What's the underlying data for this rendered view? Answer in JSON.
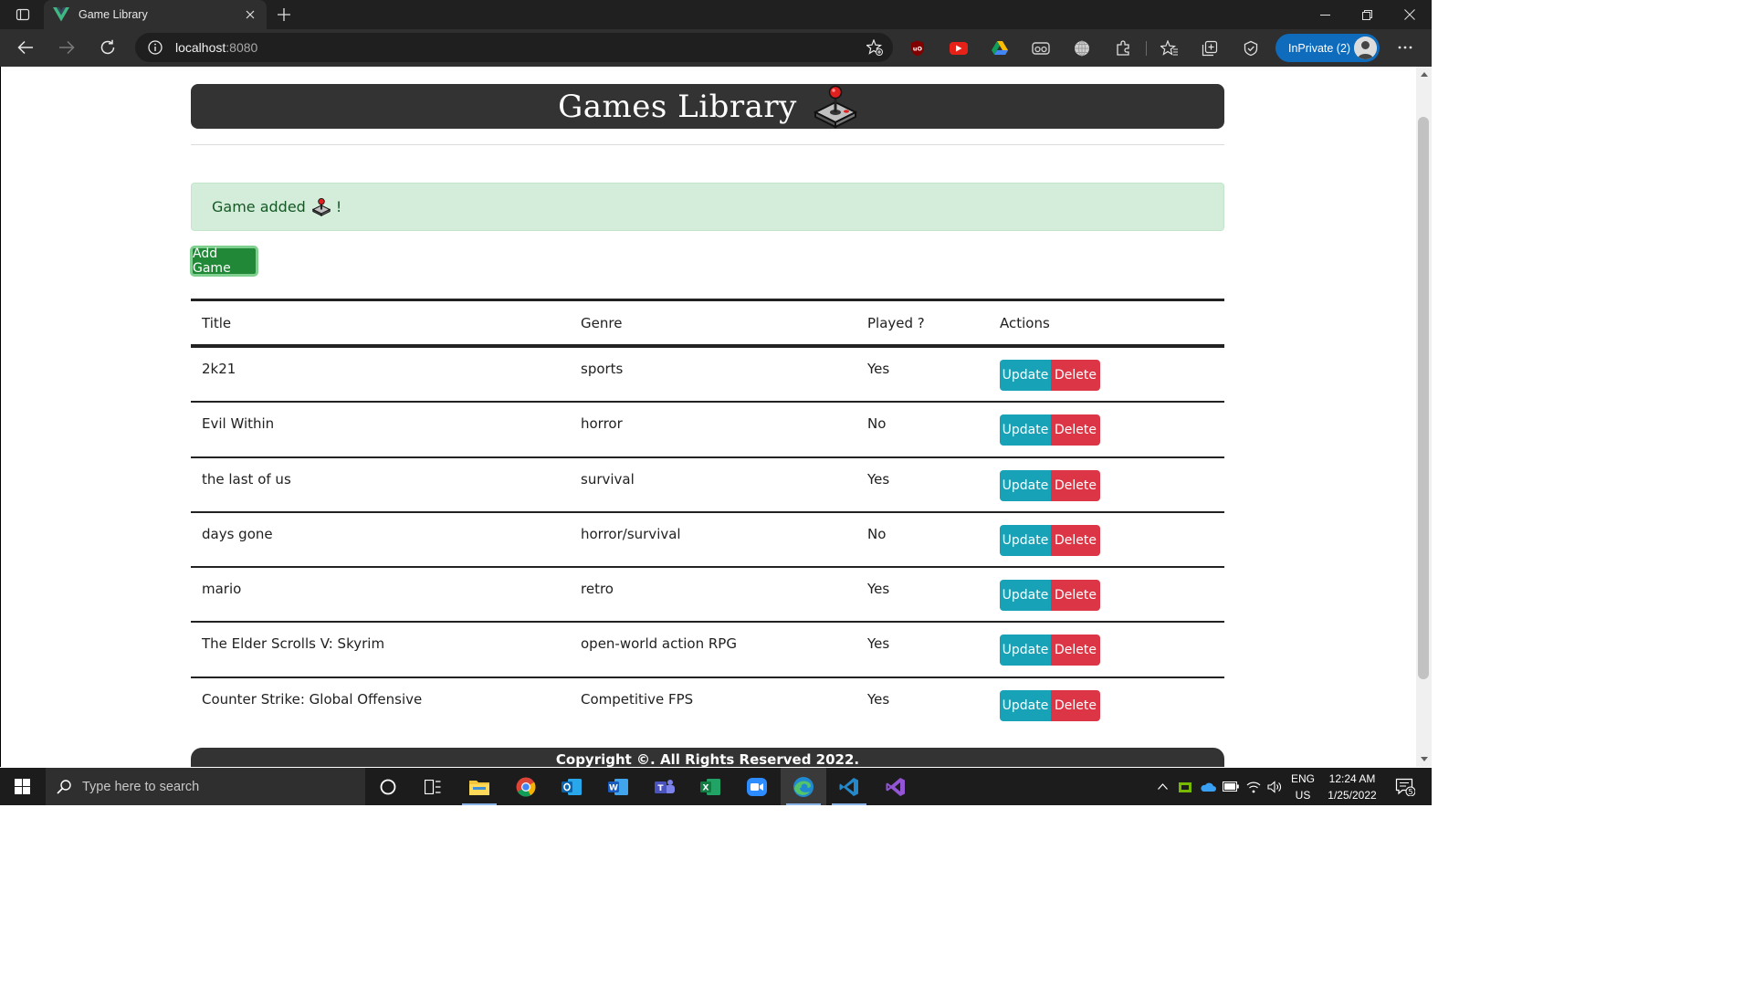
{
  "browser": {
    "tab_title": "Game Library",
    "url_host": "localhost",
    "url_port": ":8080",
    "inprivate_label": "InPrivate (2)",
    "extensions": [
      "ublock-icon",
      "youtube-ext-icon",
      "drive-ext-icon",
      "vr-ext-icon",
      "globe-ext-icon",
      "puzzle-extensions-icon"
    ]
  },
  "page": {
    "title": "Games Library",
    "alert_message": "Game added",
    "alert_suffix": "!",
    "add_button": "Add Game",
    "columns": [
      "Title",
      "Genre",
      "Played ?",
      "Actions"
    ],
    "update_label": "Update",
    "delete_label": "Delete",
    "games": [
      {
        "title": "2k21",
        "genre": "sports",
        "played": "Yes"
      },
      {
        "title": "Evil Within",
        "genre": "horror",
        "played": "No"
      },
      {
        "title": "the last of us",
        "genre": "survival",
        "played": "Yes"
      },
      {
        "title": "days gone",
        "genre": "horror/survival",
        "played": "No"
      },
      {
        "title": "mario",
        "genre": "retro",
        "played": "Yes"
      },
      {
        "title": "The Elder Scrolls V: Skyrim",
        "genre": "open-world action RPG",
        "played": "Yes"
      },
      {
        "title": "Counter Strike: Global Offensive",
        "genre": "Competitive FPS",
        "played": "Yes"
      }
    ],
    "footer": "Copyright ©. All Rights Reserved 2022."
  },
  "taskbar": {
    "search_placeholder": "Type here to search",
    "language": "ENG",
    "region": "US",
    "time": "12:24 AM",
    "date": "1/25/2022",
    "notifications": "5"
  },
  "colors": {
    "banner_bg": "#333333",
    "alert_bg": "#d4edda",
    "add_button": "#218838",
    "update_button": "#17a2b8",
    "delete_button": "#dc3545"
  }
}
